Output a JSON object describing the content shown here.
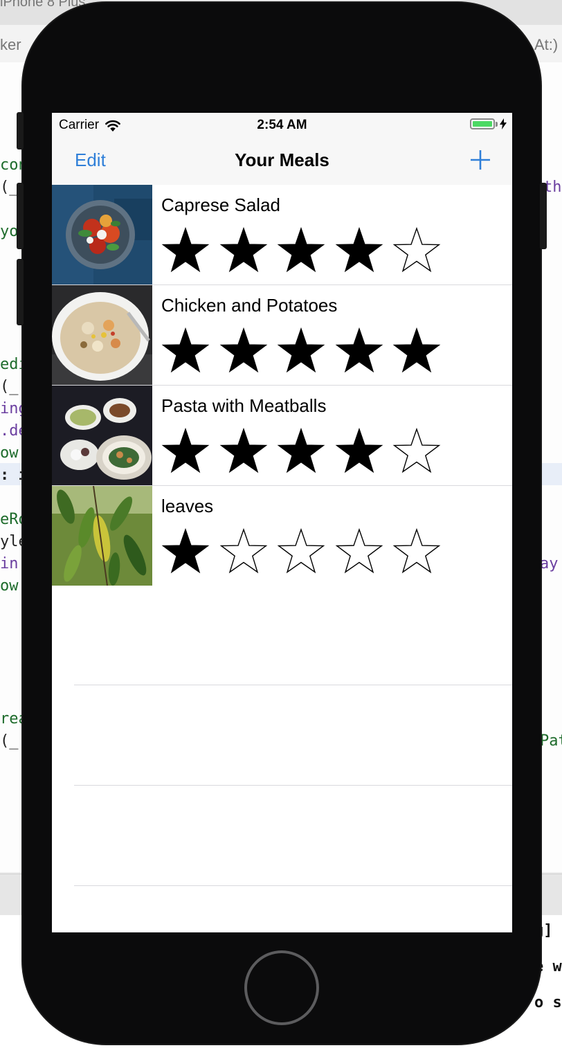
{
  "status_bar": {
    "carrier": "Carrier",
    "time": "2:54 AM",
    "wifi_icon": "wifi-icon",
    "battery_icon": "battery-charging-icon"
  },
  "nav": {
    "left_label": "Edit",
    "title": "Your Meals",
    "right_icon": "plus-icon"
  },
  "colors": {
    "accent": "#2f7fd8",
    "battery": "#4cd964"
  },
  "meals": [
    {
      "name": "Caprese Salad",
      "rating": 4,
      "max_rating": 5,
      "photo": "caprese-salad-photo"
    },
    {
      "name": "Chicken and Potatoes",
      "rating": 5,
      "max_rating": 5,
      "photo": "chicken-potatoes-photo"
    },
    {
      "name": "Pasta with Meatballs",
      "rating": 4,
      "max_rating": 5,
      "photo": "pasta-meatballs-photo"
    },
    {
      "name": "leaves",
      "rating": 1,
      "max_rating": 5,
      "photo": "leaves-photo"
    }
  ],
  "background_code": {
    "fragments": [
      "ker",
      "At:)",
      "con",
      "(_",
      "th",
      "yo",
      "edi",
      "(_",
      "ing",
      ".de",
      "ow",
      ": i",
      "eRo",
      "yle",
      " in",
      "ay",
      "ow",
      "rea",
      "(_",
      "Pat",
      "g]",
      "e w",
      "o s",
      "iPhone 8 Plus"
    ]
  }
}
